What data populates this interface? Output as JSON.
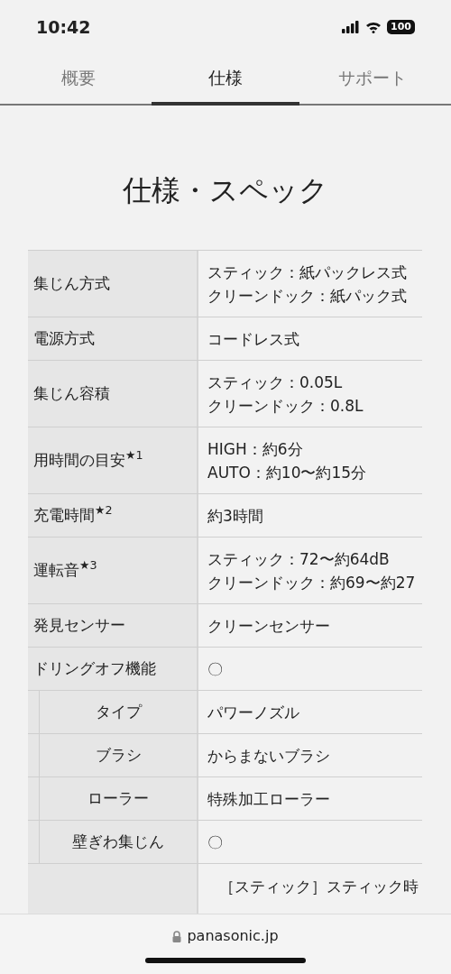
{
  "status_bar": {
    "time": "10:42",
    "battery": "100"
  },
  "tabs": [
    {
      "label": "概要",
      "selected": false
    },
    {
      "label": "仕様",
      "selected": true
    },
    {
      "label": "サポート",
      "selected": false
    }
  ],
  "title": "仕様・スペック",
  "spec_rows": [
    {
      "kind": "main",
      "label": "集じん方式",
      "values": [
        "スティック：紙パックレス式",
        "クリーンドック：紙パック式"
      ]
    },
    {
      "kind": "main",
      "label": "電源方式",
      "values": [
        "コードレス式"
      ]
    },
    {
      "kind": "main",
      "label": "集じん容積",
      "values": [
        "スティック：0.05L",
        "クリーンドック：0.8L"
      ]
    },
    {
      "kind": "main",
      "label": "用時間の目安$^{★1}$",
      "values": [
        "HIGH：約6分",
        "AUTO：約10〜約15分"
      ]
    },
    {
      "kind": "main",
      "label": "充電時間$^{★2}$",
      "values": [
        "約3時間"
      ]
    },
    {
      "kind": "main",
      "label": "運転音$^{★3}$",
      "values": [
        "スティック：72〜約64dB",
        "クリーンドック：約69〜約27"
      ]
    },
    {
      "kind": "main",
      "label": "発見センサー",
      "values": [
        "クリーンセンサー"
      ]
    },
    {
      "kind": "main",
      "label": "ドリングオフ機能",
      "values": [
        "〇"
      ]
    },
    {
      "kind": "sub",
      "label": "タイプ",
      "values": [
        "パワーノズル"
      ]
    },
    {
      "kind": "sub",
      "label": "ブラシ",
      "values": [
        "からまないブラシ"
      ]
    },
    {
      "kind": "sub",
      "label": "ローラー",
      "values": [
        "特殊加工ローラー"
      ]
    },
    {
      "kind": "sub",
      "label": "壁ぎわ集じん",
      "values": [
        "〇"
      ]
    },
    {
      "kind": "tall",
      "values": [
        "［スティック］スティック時"
      ]
    }
  ],
  "address_bar": {
    "url": "panasonic.jp"
  }
}
